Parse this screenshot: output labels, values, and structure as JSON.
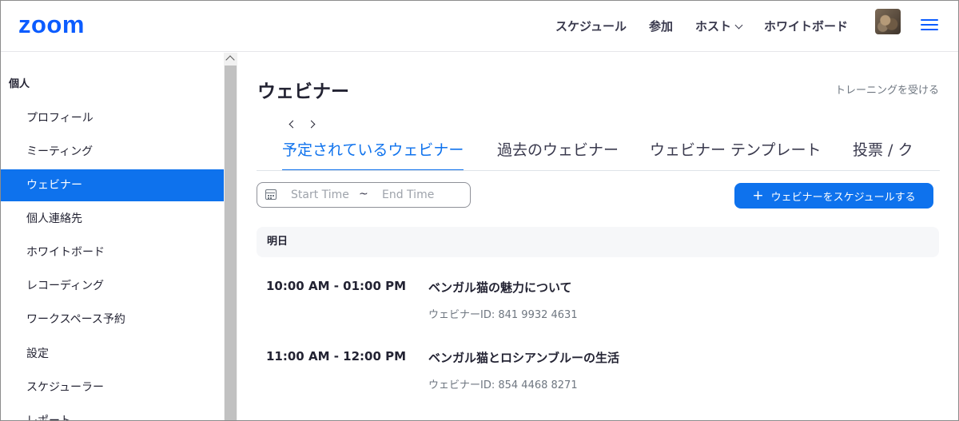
{
  "header": {
    "logo": "zoom",
    "nav": [
      {
        "label": "スケジュール",
        "dropdown": false
      },
      {
        "label": "参加",
        "dropdown": false
      },
      {
        "label": "ホスト",
        "dropdown": true
      },
      {
        "label": "ホワイトボード",
        "dropdown": false
      }
    ],
    "accent_color": "#0b5cff"
  },
  "sidebar": {
    "section": "個人",
    "items": [
      {
        "label": "プロフィール",
        "active": false
      },
      {
        "label": "ミーティング",
        "active": false
      },
      {
        "label": "ウェビナー",
        "active": true
      },
      {
        "label": "個人連絡先",
        "active": false
      },
      {
        "label": "ホワイトボード",
        "active": false
      },
      {
        "label": "レコーディング",
        "active": false
      },
      {
        "label": "ワークスペース予約",
        "active": false
      },
      {
        "label": "設定",
        "active": false
      },
      {
        "label": "スケジューラー",
        "active": false
      },
      {
        "label": "レポート",
        "active": false
      }
    ],
    "active_color": "#0e72ed"
  },
  "main": {
    "title": "ウェビナー",
    "training_link": "トレーニングを受ける",
    "tabs": [
      {
        "label": "予定されているウェビナー",
        "active": true
      },
      {
        "label": "過去のウェビナー",
        "active": false
      },
      {
        "label": "ウェビナー テンプレート",
        "active": false
      },
      {
        "label": "投票 / ク",
        "active": false
      }
    ],
    "date_range": {
      "start_placeholder": "Start Time",
      "separator": "~",
      "end_placeholder": "End Time"
    },
    "schedule_button": "ウェビナーをスケジュールする",
    "day_header": "明日",
    "webinars": [
      {
        "time": "10:00 AM - 01:00 PM",
        "title": "ベンガル猫の魅力について",
        "id": "ウェビナーID: 841 9932 4631"
      },
      {
        "time": "11:00 AM - 12:00 PM",
        "title": "ベンガル猫とロシアンブルーの生活",
        "id": "ウェビナーID: 854 4468 8271"
      }
    ]
  }
}
